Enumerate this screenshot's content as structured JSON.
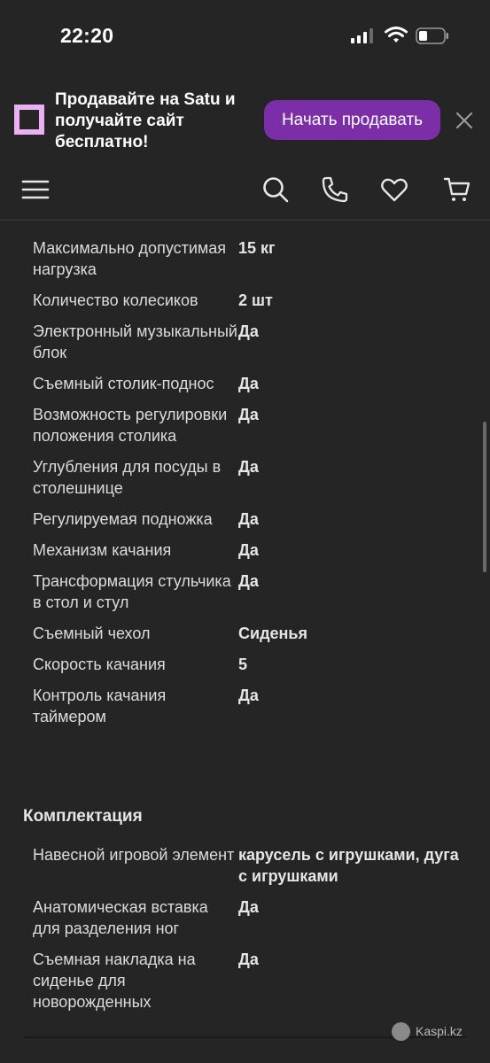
{
  "status_bar": {
    "time": "22:20"
  },
  "banner": {
    "text": "Продавайте на Satu и получайте сайт бесплатно!",
    "button_label": "Начать продавать"
  },
  "nav": {
    "icons": [
      "menu-icon",
      "search-icon",
      "phone-icon",
      "heart-icon",
      "cart-icon"
    ]
  },
  "specs_before": [
    {
      "label": "Максимально допустимая нагрузка",
      "value": "15 кг"
    },
    {
      "label": "Количество колесиков",
      "value": "2 шт"
    },
    {
      "label": "Электронный музыкальный блок",
      "value": "Да"
    },
    {
      "label": "Съемный столик-поднос",
      "value": "Да"
    },
    {
      "label": "Возможность регулировки положения столика",
      "value": "Да"
    },
    {
      "label": "Углубления для посуды в столешнице",
      "value": "Да"
    },
    {
      "label": "Регулируемая подножка",
      "value": "Да"
    },
    {
      "label": "Механизм качания",
      "value": "Да"
    },
    {
      "label": "Трансформация стульчика в стол и стул",
      "value": "Да"
    },
    {
      "label": "Съемный чехол",
      "value": "Сиденья"
    },
    {
      "label": "Скорость качания",
      "value": "5"
    },
    {
      "label": "Контроль качания таймером",
      "value": "Да"
    }
  ],
  "section_heading": "Комплектация",
  "specs_after": [
    {
      "label": "Навесной игровой элемент",
      "value": "карусель с игрушками, дуга с игрушками"
    },
    {
      "label": "Анатомическая вставка для разделения ног",
      "value": "Да"
    },
    {
      "label": "Съемная накладка на сиденье для новорожденных",
      "value": "Да"
    }
  ],
  "watermark": "Kaspi.kz"
}
